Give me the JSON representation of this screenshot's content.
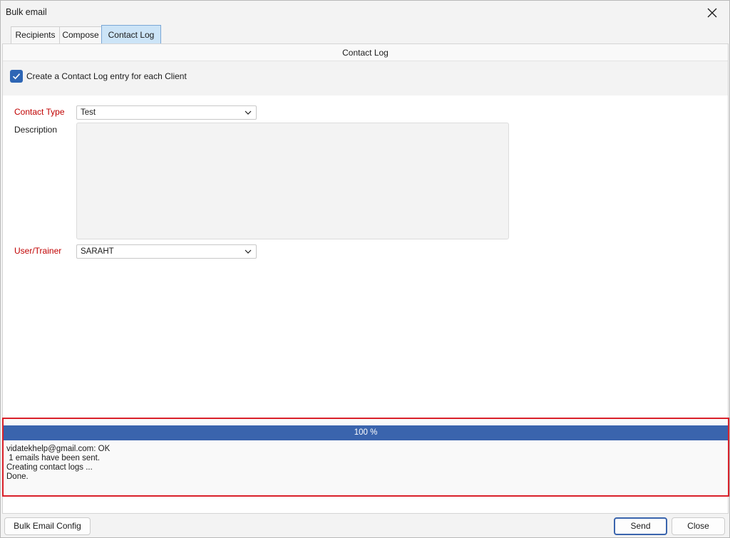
{
  "window": {
    "title": "Bulk email",
    "close_icon": "close-icon"
  },
  "tabs": [
    {
      "label": "Recipients",
      "active": false
    },
    {
      "label": "Compose",
      "active": false
    },
    {
      "label": "Contact Log",
      "active": true
    }
  ],
  "section": {
    "title": "Contact Log"
  },
  "contact_log": {
    "create_entry_label": "Create a Contact Log entry for each Client",
    "create_entry_checked": true
  },
  "form": {
    "contact_type_label": "Contact Type",
    "contact_type_value": "Test",
    "description_label": "Description",
    "description_value": "",
    "user_trainer_label": "User/Trainer",
    "user_trainer_value": "SARAHT"
  },
  "status": {
    "progress_percent": 100,
    "progress_label": "100 %",
    "log_lines": [
      "vidatekhelp@gmail.com: OK",
      " 1 emails have been sent.",
      "Creating contact logs ...",
      "Done."
    ]
  },
  "footer": {
    "config_label": "Bulk Email Config",
    "send_label": "Send",
    "close_label": "Close"
  },
  "colors": {
    "accent": "#3a64ad",
    "required": "#c00000",
    "highlight_border": "#d9212a",
    "active_tab": "#cce4f7"
  }
}
